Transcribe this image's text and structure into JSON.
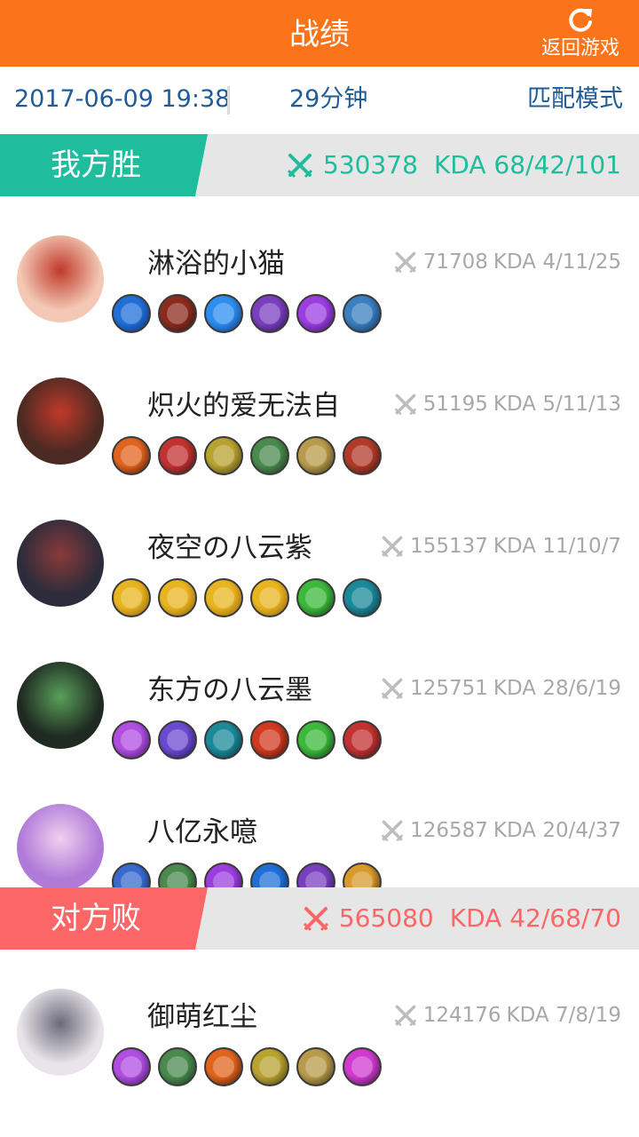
{
  "header": {
    "title": "战绩",
    "back_label": "返回游戏"
  },
  "info": {
    "datetime": "2017-06-09 19:38",
    "duration": "29分钟",
    "mode": "匹配模式"
  },
  "teams": [
    {
      "label": "我方胜",
      "color": "#1dbd9d",
      "damage": "530378",
      "kda": "KDA 68/42/101",
      "players": [
        {
          "name": "淋浴的小猫",
          "damage": "71708",
          "kda": "KDA 4/11/25",
          "items": [
            "blue-staff-item",
            "red-boots-item",
            "blue-sword-item",
            "purple-orb-item",
            "purple-fist-item",
            "blue-hammer-item"
          ]
        },
        {
          "name": "炽火的爱无法自",
          "damage": "51195",
          "kda": "KDA 5/11/13",
          "items": [
            "fire-blade-item",
            "axe-item",
            "gold-helm-item",
            "green-boots-item",
            "gold-armor-item",
            "red-ring-item"
          ]
        },
        {
          "name": "夜空の八云紫",
          "damage": "155137",
          "kda": "KDA 11/10/7",
          "items": [
            "gold-crest-item",
            "gold-crest-item",
            "gold-crest-item",
            "gold-crest-item",
            "green-blade-item",
            "teal-claw-item"
          ]
        },
        {
          "name": "东方の八云墨",
          "damage": "125751",
          "kda": "KDA 28/6/19",
          "items": [
            "purple-sword-item",
            "purple-blade-item",
            "teal-claw-item",
            "red-armor-item",
            "green-blade-item",
            "axe-item"
          ]
        },
        {
          "name": "八亿永噫",
          "damage": "126587",
          "kda": "KDA 20/4/37",
          "items": [
            "blue-shield-item",
            "green-boots-item",
            "purple-fist-item",
            "blue-staff-item",
            "purple-orb-item",
            "gold-hourglass-item"
          ]
        }
      ]
    },
    {
      "label": "对方败",
      "color": "#fd6666",
      "damage": "565080",
      "kda": "KDA 42/68/70",
      "players": [
        {
          "name": "御萌红尘",
          "damage": "124176",
          "kda": "KDA 7/8/19",
          "items": [
            "purple-sword-item",
            "green-boots-item",
            "fire-blade-item",
            "gold-helm-item",
            "gold-armor-item",
            "pink-crystal-item"
          ]
        }
      ]
    }
  ],
  "colors": {
    "header_bg": "#fc7419",
    "info_text": "#1f5c98",
    "stat_gray": "#a8a8a8",
    "banner_bg": "#e6e6e6"
  }
}
